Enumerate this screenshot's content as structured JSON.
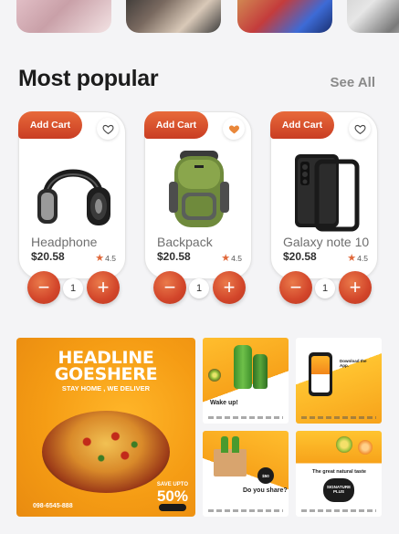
{
  "section": {
    "title": "Most popular",
    "see_all": "See All"
  },
  "products": [
    {
      "add_cart": "Add Cart",
      "name": "Headphone",
      "price": "$20.58",
      "rating": "4.5",
      "qty": "1",
      "favorited": false,
      "icon": "headphones"
    },
    {
      "add_cart": "Add Cart",
      "name": "Backpack",
      "price": "$20.58",
      "rating": "4.5",
      "qty": "1",
      "favorited": true,
      "icon": "backpack"
    },
    {
      "add_cart": "Add Cart",
      "name": "Galaxy note 10",
      "price": "$20.58",
      "rating": "4.5",
      "qty": "1",
      "favorited": false,
      "icon": "smartphone"
    }
  ],
  "promo": {
    "big": {
      "headline_1": "HEADLINE",
      "headline_2": "GOESHERE",
      "subline": "STAY HOME , WE DELIVER",
      "save_label": "SAVE UPTO",
      "save_value": "50%",
      "phone": "098-6545-888"
    },
    "small": [
      {
        "caption": "Wake up!"
      },
      {
        "caption": "Download the App."
      },
      {
        "caption": "Do you share?"
      },
      {
        "caption": "The great natural taste"
      }
    ]
  },
  "colors": {
    "accent": "#d8492b",
    "background": "#f4f4f6",
    "heart_active": "#e9873a"
  }
}
